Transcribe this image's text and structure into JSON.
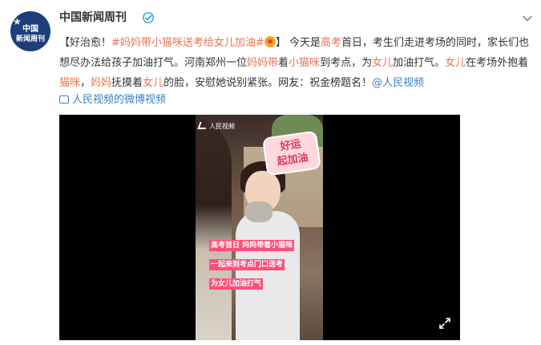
{
  "account": {
    "name": "中国新闻周刊",
    "avatar_lines": [
      "中国",
      "新闻周刊"
    ],
    "verified_icon": "verified-badge-icon",
    "more_icon": "chevron-down-icon"
  },
  "post": {
    "bracket_open": "【好治愈！",
    "hashtag": "#妈妈带小猫咪送考给女儿加油#",
    "bracket_close": "】",
    "t1": "今天是",
    "h_gaokao": "高考",
    "t2": "首日，考生们走进考场的同时，家长们也想尽办法给孩子加油打气。河南郑州一位",
    "h_mama1": "妈妈带",
    "t3": "着",
    "h_xiaomaomi": "小猫咪",
    "t4": "到考点，为",
    "h_nver1": "女儿",
    "t5": "加油打气。",
    "h_nver2": "女儿",
    "t6": "在考场外抱着",
    "h_maomi": "猫咪",
    "t7": "，",
    "h_mama2": "妈妈",
    "t8": "抚摸着",
    "h_nver3": "女儿",
    "t9": "的脸，安慰她说别紧张。网友：祝金榜题名！",
    "mention": "@人民视频",
    "video_link": "人民视频的微博视频"
  },
  "video": {
    "watermark": "人民视频",
    "sticker_line1": "好运",
    "sticker_line2": "起加油",
    "captions": [
      "高考首日 妈妈带着小猫咪",
      "一起来到考点门口送考",
      "为女儿加油打气"
    ],
    "fullscreen_icon": "fullscreen-icon"
  },
  "colors": {
    "accent": "#eb7350",
    "link": "#3b7fc4",
    "caption_bg": "#ff4f79"
  }
}
